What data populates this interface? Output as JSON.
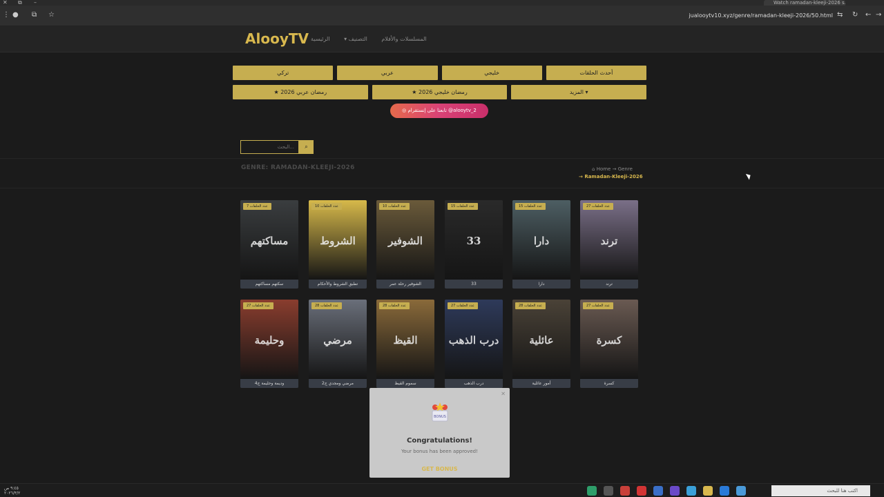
{
  "browser": {
    "tab_title": "Watch ramadan-kleeji-2026 s...",
    "url": "jualooytv10.xyz/genre/ramadan-kleeji-2026/50.html"
  },
  "header": {
    "logo": "AlooyTV",
    "nav": [
      "المسلسلات والأفلام",
      "التصنيف ▾",
      "الرئيسية"
    ]
  },
  "categories_row1": [
    "تركي",
    "عربي",
    "خليجي",
    "أحدث الحلقات"
  ],
  "categories_row2": [
    "★ رمضان عربي 2026",
    "★ رمضان خليجي 2026",
    "المزيد ▾"
  ],
  "instagram": {
    "label": "تابعنا على إنستقرام",
    "handle": "@alooytv_2"
  },
  "search": {
    "placeholder": "البحث..."
  },
  "genre": {
    "title": "GENRE: RAMADAN-KLEEJI-2026",
    "breadcrumb_home": "Home",
    "breadcrumb_genre": "Genre",
    "breadcrumb_current": "Ramadan-Kleeji-2026"
  },
  "cards": [
    {
      "badge": "عدد الحلقات 7",
      "title": "سكتهم مساكتهم",
      "poster_text": "مساكتهم",
      "color": "#3a3d3f"
    },
    {
      "badge": "عدد الحلقات 10",
      "title": "تطبق الشروط والأحكام",
      "poster_text": "الشروط",
      "color": "#d7b94a"
    },
    {
      "badge": "عدد الحلقات 10",
      "title": "الشوفير رحلة عمر",
      "poster_text": "الشوفير",
      "color": "#6a5a3a"
    },
    {
      "badge": "عدد الحلقات 15",
      "title": "33",
      "poster_text": "33",
      "color": "#2a2a2a"
    },
    {
      "badge": "عدد الحلقات 15",
      "title": "دارا",
      "poster_text": "دارا",
      "color": "#4d5e63"
    },
    {
      "badge": "عدد الحلقات 27",
      "title": "ترند",
      "poster_text": "ترند",
      "color": "#7a6f88"
    },
    {
      "badge": "عدد الحلقات 27",
      "title": "وديمة وحليمة ج4",
      "poster_text": "وحليمة",
      "color": "#8a3d2e"
    },
    {
      "badge": "عدد الحلقات 28",
      "title": "مرضي ومجدي ج2",
      "poster_text": "مرضي",
      "color": "#6a6f7a"
    },
    {
      "badge": "عدد الحلقات 28",
      "title": "سموم القيظ",
      "poster_text": "القيظ",
      "color": "#8a6a3a"
    },
    {
      "badge": "عدد الحلقات 27",
      "title": "درب الذهب",
      "poster_text": "درب الذهب",
      "color": "#2e3a5a"
    },
    {
      "badge": "عدد الحلقات 28",
      "title": "أمور عائلية",
      "poster_text": "عائلية",
      "color": "#4a4237"
    },
    {
      "badge": "عدد الحلقات 27",
      "title": "كسرة",
      "poster_text": "كسرة",
      "color": "#6a5a52"
    }
  ],
  "popup": {
    "title": "Congratulations!",
    "message": "Your bonus has been approved!",
    "cta": "GET BONUS",
    "badge": "BONUS"
  },
  "taskbar": {
    "search_placeholder": "اكتب هنا للبحث",
    "time": "٩:٤٥ ص",
    "date": "٢٠٢٦/٣/٢"
  }
}
